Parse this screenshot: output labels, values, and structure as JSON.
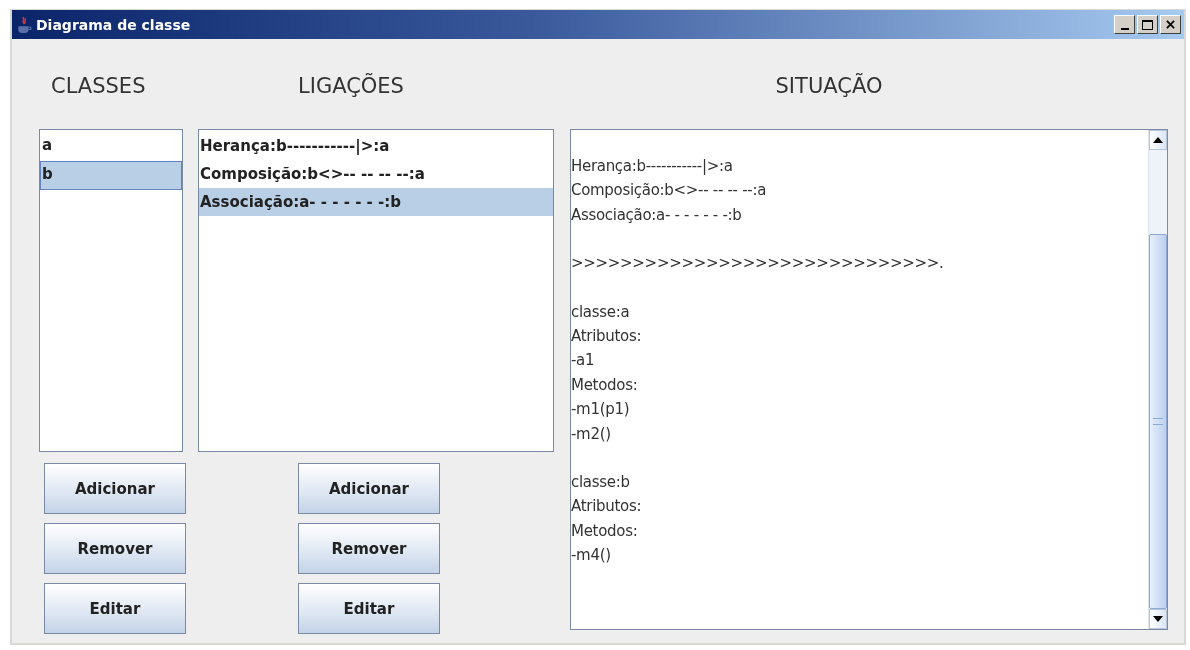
{
  "window": {
    "title": "Diagrama de classe"
  },
  "classes": {
    "heading": "CLASSES",
    "items": [
      {
        "label": "a",
        "selected": false
      },
      {
        "label": "b",
        "selected": true
      }
    ],
    "buttons": [
      "Adicionar",
      "Remover",
      "Editar"
    ]
  },
  "links": {
    "heading": "LIGAÇÕES",
    "items": [
      {
        "label": "Herança:b-----------|>:a",
        "selected": false
      },
      {
        "label": "Composição:b<>-- -- -- --:a",
        "selected": false
      },
      {
        "label": "Associação:a- - - - - - -:b",
        "selected": true
      }
    ],
    "buttons": [
      "Adicionar",
      "Remover",
      "Editar"
    ]
  },
  "situation": {
    "heading": "SITUAÇÃO",
    "blocks": [
      [
        "Herança:b-----------|>:a",
        "Composição:b<>-- -- -- --:a",
        "Associação:a- - - - - - -:b"
      ],
      [
        ">>>>>>>>>>>>>>>>>>>>>>>>>>>>>>."
      ],
      [
        "classe:a",
        "Atributos:",
        "-a1",
        "Metodos:",
        "-m1(p1)",
        "-m2()"
      ],
      [
        "classe:b",
        "Atributos:",
        "Metodos:",
        "-m4()"
      ]
    ]
  }
}
